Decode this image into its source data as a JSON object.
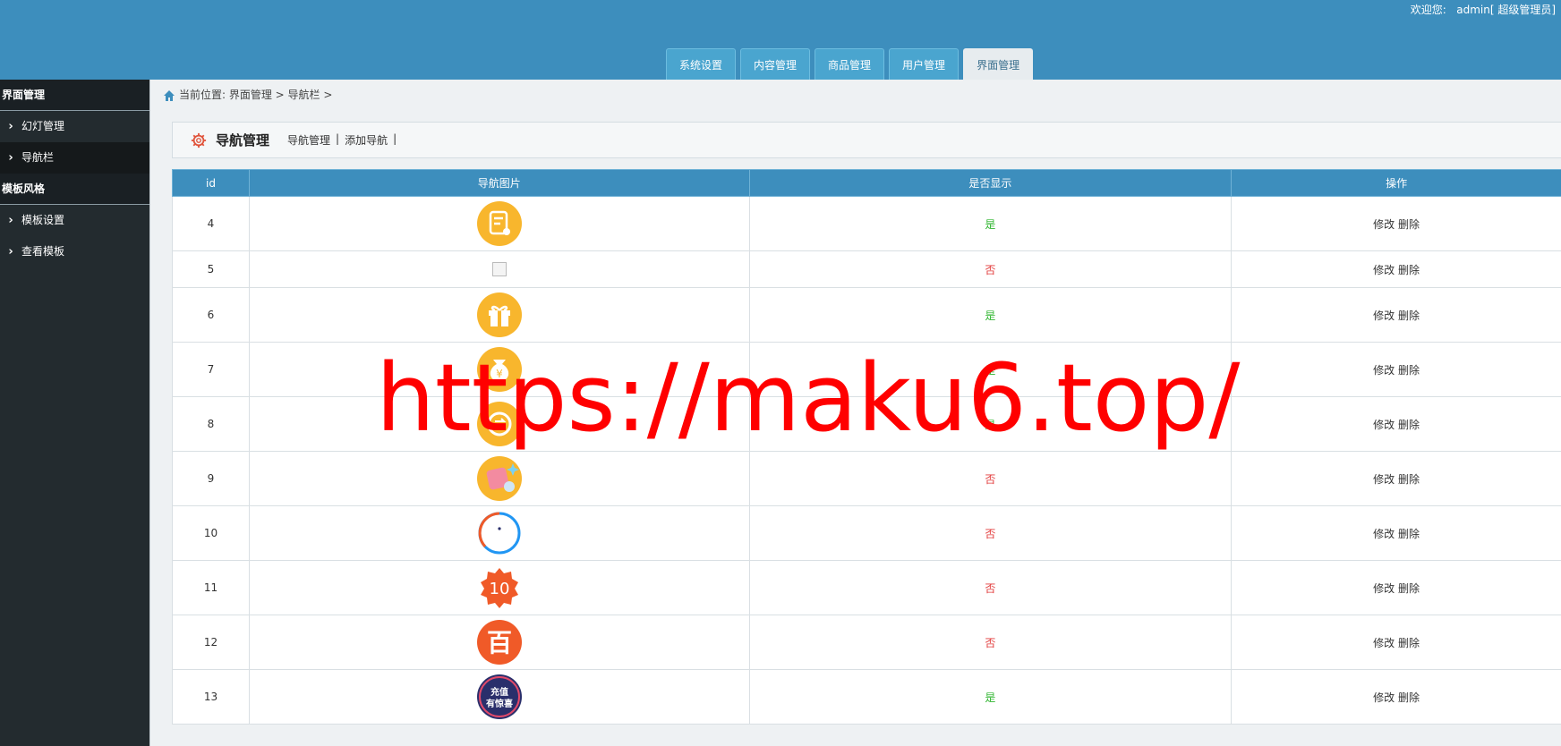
{
  "header": {
    "welcome": "欢迎您:   admin[ 超级管理员]",
    "tabs": [
      "系统设置",
      "内容管理",
      "商品管理",
      "用户管理",
      "界面管理"
    ],
    "active_tab": 4
  },
  "sidebar": {
    "section1": "界面管理",
    "items1": [
      "幻灯管理",
      "导航栏"
    ],
    "section2": "模板风格",
    "items2": [
      "模板设置",
      "查看模板"
    ]
  },
  "breadcrumb": "当前位置: 界面管理 > 导航栏 >",
  "panel": {
    "title": "导航管理",
    "link1": "导航管理",
    "link2": "添加导航",
    "sep": "|"
  },
  "table": {
    "headers": [
      "id",
      "导航图片",
      "是否显示",
      "操作"
    ],
    "edit_label": "修改",
    "delete_label": "删除",
    "rows": [
      {
        "id": "4",
        "icon": "note-icon",
        "show": "是",
        "color": "#f8b62d"
      },
      {
        "id": "5",
        "icon": "broken-image-icon",
        "show": "否",
        "color": ""
      },
      {
        "id": "6",
        "icon": "gift-icon",
        "show": "是",
        "color": "#f8b62d"
      },
      {
        "id": "7",
        "icon": "money-bag-icon",
        "show": "是",
        "color": "#f8b62d"
      },
      {
        "id": "8",
        "icon": "exchange-icon",
        "show": "是",
        "color": "#f8b62d"
      },
      {
        "id": "9",
        "icon": "promo-icon",
        "show": "否",
        "color": "#f8b62d"
      },
      {
        "id": "10",
        "icon": "clock-icon",
        "show": "否",
        "color": "#ffffff"
      },
      {
        "id": "11",
        "icon": "badge-10-icon",
        "show": "否",
        "color": "#f05a28"
      },
      {
        "id": "12",
        "icon": "bai-icon",
        "show": "否",
        "color": "#f05a28"
      },
      {
        "id": "13",
        "icon": "recharge-icon",
        "show": "是",
        "color": "#2a2f6b"
      }
    ],
    "badge_text": "10",
    "bai_text": "百",
    "recharge_text": "充值有惊喜",
    "yuan_text": "¥"
  },
  "watermark": "https://maku6.top/"
}
